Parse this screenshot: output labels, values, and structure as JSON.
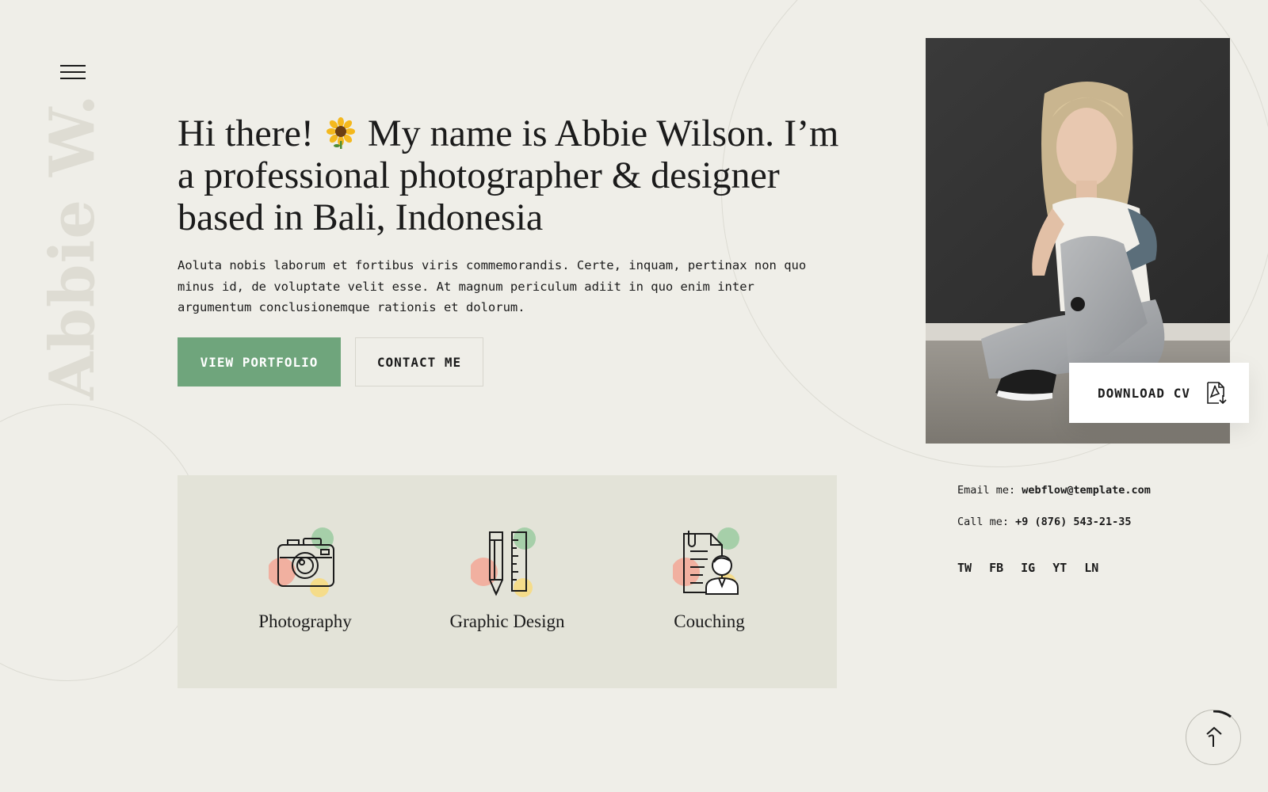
{
  "site": {
    "vertical_name": "Abbie W."
  },
  "hero": {
    "headline_before": "Hi there!",
    "headline_after": "My name is Abbie Wilson. I’m a professional photographer & designer based in Bali, Indonesia",
    "emoji_icon": "sunflower-icon",
    "intro": "Aoluta nobis laborum et fortibus viris commemorandis. Certe, inquam, pertinax non quo minus id, de voluptate velit esse. At magnum periculum adiit in quo enim inter argumentum conclusionemque rationis et dolorum.",
    "primary_button": "VIEW PORTFOLIO",
    "secondary_button": "CONTACT ME"
  },
  "services": [
    {
      "label": "Photography",
      "icon": "camera-icon"
    },
    {
      "label": "Graphic Design",
      "icon": "pencil-ruler-icon"
    },
    {
      "label": "Couching",
      "icon": "document-person-icon"
    }
  ],
  "profile": {
    "download_label": "DOWNLOAD CV",
    "download_icon": "pdf-download-icon",
    "email_label": "Email me:",
    "email": "webflow@template.com",
    "call_label": "Call me:",
    "phone": "+9 (876) 543-21-35",
    "socials": [
      "TW",
      "FB",
      "IG",
      "YT",
      "LN"
    ]
  },
  "colors": {
    "background": "#efeee8",
    "accent_green": "#6fa57c",
    "panel": "#e3e3d8",
    "dot_green": "#a6cfa9",
    "dot_pink": "#f1b0a0",
    "dot_yellow": "#f5dc8a"
  }
}
